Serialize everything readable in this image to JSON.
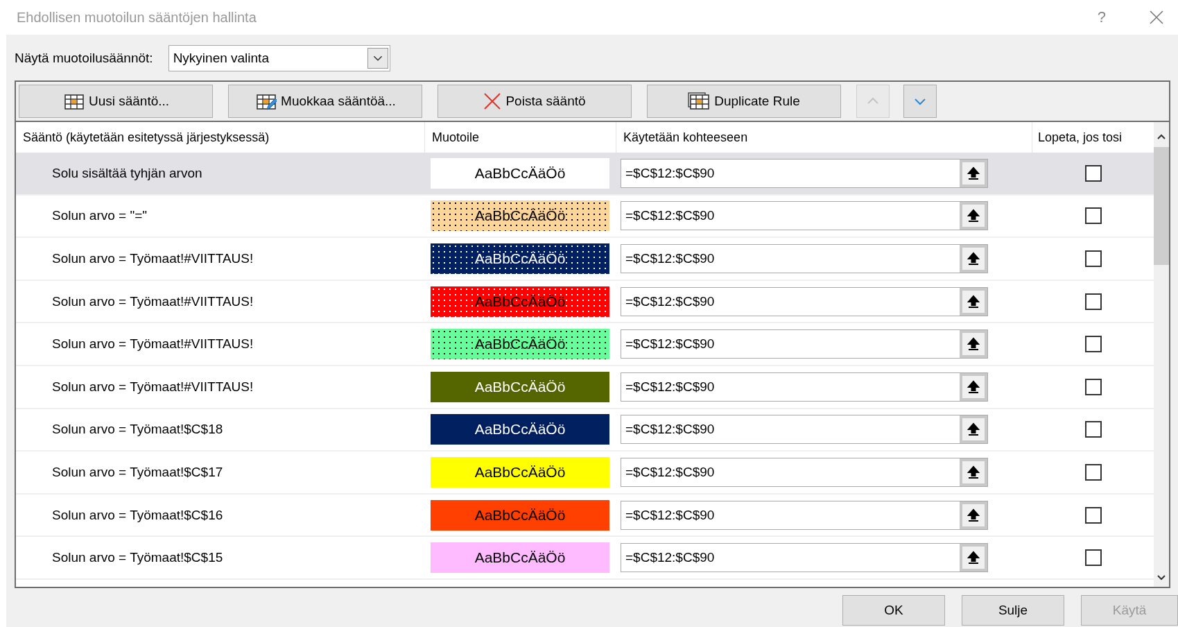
{
  "window": {
    "title": "Ehdollisen muotoilun sääntöjen hallinta",
    "help": "?"
  },
  "show_rules": {
    "label": "Näytä muotoilusäännöt:",
    "value": "Nykyinen valinta"
  },
  "toolbar": [
    {
      "kind": "new",
      "label": "Uusi sääntö..."
    },
    {
      "kind": "edit",
      "label": "Muokkaa sääntöä..."
    },
    {
      "kind": "delete",
      "label": "Poista sääntö"
    },
    {
      "kind": "duplicate",
      "label": "Duplicate Rule"
    }
  ],
  "move_buttons": [
    {
      "kind": "up",
      "disabled": true
    },
    {
      "kind": "down",
      "disabled": false
    }
  ],
  "table": {
    "columns": [
      "Sääntö (käytetään esitetyssä järjestyksessä)",
      "Muotoile",
      "Käytetään kohteeseen",
      "Lopeta, jos tosi"
    ],
    "rows": [
      {
        "rule": "Solu sisältää tyhjän arvon",
        "preview": {
          "text": "AaBbCcÄäÖö",
          "color": "#ffffff",
          "kind": "solid"
        },
        "applies_to": "=$C$12:$C$90",
        "stop": false,
        "selected": true
      },
      {
        "rule": "Solun arvo = \"=\"",
        "preview": {
          "text": "AaBbCcÄäÖö",
          "color": "#fcd59a",
          "kind": "darkdots"
        },
        "applies_to": "=$C$12:$C$90",
        "stop": false,
        "selected": false
      },
      {
        "rule": "Solun arvo = Työmaat!#VIITTAUS!",
        "preview": {
          "text": "AaBbCcÄäÖö",
          "color": "#002060",
          "kind": "lightdots"
        },
        "applies_to": "=$C$12:$C$90",
        "stop": false,
        "selected": false
      },
      {
        "rule": "Solun arvo = Työmaat!#VIITTAUS!",
        "preview": {
          "text": "AaBbCcÄäÖö",
          "color": "#ff0000",
          "kind": "lightdots"
        },
        "applies_to": "=$C$12:$C$90",
        "stop": false,
        "selected": false
      },
      {
        "rule": "Solun arvo = Työmaat!#VIITTAUS!",
        "preview": {
          "text": "AaBbCcÄäÖö",
          "color": "#66ff99",
          "kind": "darkdots"
        },
        "applies_to": "=$C$12:$C$90",
        "stop": false,
        "selected": false
      },
      {
        "rule": "Solun arvo = Työmaat!#VIITTAUS!",
        "preview": {
          "text": "AaBbCcÄäÖö",
          "color": "#556600",
          "kind": "solid"
        },
        "applies_to": "=$C$12:$C$90",
        "stop": false,
        "selected": false
      },
      {
        "rule": "Solun arvo = Työmaat!$C$18",
        "preview": {
          "text": "AaBbCcÄäÖö",
          "color": "#002060",
          "kind": "solid"
        },
        "applies_to": "=$C$12:$C$90",
        "stop": false,
        "selected": false
      },
      {
        "rule": "Solun arvo = Työmaat!$C$17",
        "preview": {
          "text": "AaBbCcÄäÖö",
          "color": "#ffff00",
          "kind": "solid"
        },
        "applies_to": "=$C$12:$C$90",
        "stop": false,
        "selected": false
      },
      {
        "rule": "Solun arvo = Työmaat!$C$16",
        "preview": {
          "text": "AaBbCcÄäÖö",
          "color": "#ff4000",
          "kind": "solid"
        },
        "applies_to": "=$C$12:$C$90",
        "stop": false,
        "selected": false
      },
      {
        "rule": "Solun arvo = Työmaat!$C$15",
        "preview": {
          "text": "AaBbCcÄäÖö",
          "color": "#ffbbff",
          "kind": "solid"
        },
        "applies_to": "=$C$12:$C$90",
        "stop": false,
        "selected": false
      }
    ]
  },
  "buttons": [
    {
      "label": "OK",
      "disabled": false
    },
    {
      "label": "Sulje",
      "disabled": false
    },
    {
      "label": "Käytä",
      "disabled": true
    }
  ]
}
